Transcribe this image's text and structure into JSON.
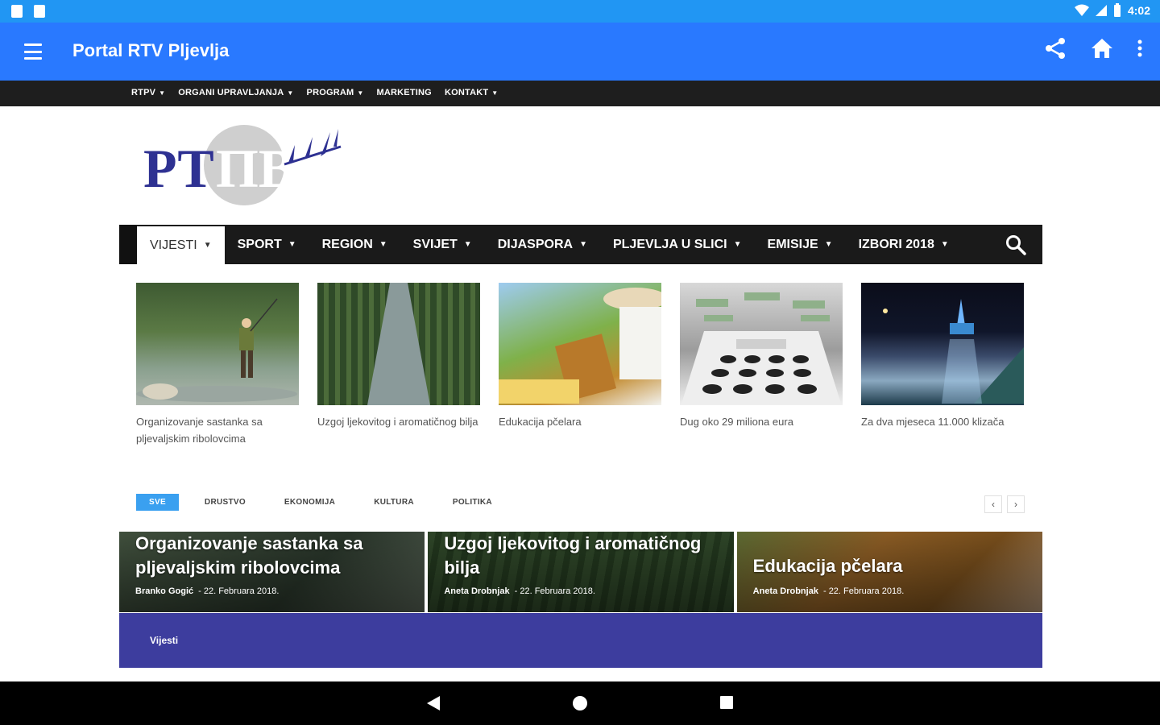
{
  "status_bar": {
    "time": "4:02"
  },
  "app_bar": {
    "title": "Portal RTV Pljevlja"
  },
  "top_nav": {
    "items": [
      {
        "label": "RTPV",
        "caret": true
      },
      {
        "label": "ORGANI UPRAVLJANJA",
        "caret": true
      },
      {
        "label": "PROGRAM",
        "caret": true
      },
      {
        "label": "MARKETING",
        "caret": false
      },
      {
        "label": "KONTAKT",
        "caret": true
      }
    ]
  },
  "logo": {
    "text_left": "РТ",
    "text_circle": "ПВ"
  },
  "main_nav": {
    "items": [
      {
        "label": "VIJESTI",
        "active": true
      },
      {
        "label": "SPORT",
        "active": false
      },
      {
        "label": "REGION",
        "active": false
      },
      {
        "label": "SVIJET",
        "active": false
      },
      {
        "label": "DIJASPORA",
        "active": false
      },
      {
        "label": "PLJEVLJA U SLICI",
        "active": false
      },
      {
        "label": "EMISIJE",
        "active": false
      },
      {
        "label": "IZBORI 2018",
        "active": false
      }
    ]
  },
  "featured": [
    {
      "caption": "Organizovanje sastanka sa pljevaljskim ribolovcima",
      "image": "fisherman"
    },
    {
      "caption": "Uzgoj ljekovitog i aromatičnog bilja",
      "image": "plant-nursery"
    },
    {
      "caption": "Edukacija pčelara",
      "image": "beekeeper"
    },
    {
      "caption": "Dug oko 29 miliona eura",
      "image": "calculator-money"
    },
    {
      "caption": "Za dva mjeseca 11.000 klizača",
      "image": "ice-rink-night"
    }
  ],
  "tabs": [
    "SVE",
    "DRUSTVO",
    "EKONOMIJA",
    "KULTURA",
    "POLITIKA"
  ],
  "big_articles": [
    {
      "title": "Organizovanje sastanka sa pljevaljskim ribolovcima",
      "author": "Branko Gogić",
      "date": "22. Februara 2018."
    },
    {
      "title": "Uzgoj ljekovitog i aromatičnog bilja",
      "author": "Aneta Drobnjak",
      "date": "22. Februara 2018."
    },
    {
      "title": "Edukacija pčelara",
      "author": "Aneta Drobnjak",
      "date": "22. Februara 2018."
    }
  ],
  "section": {
    "label": "Vijesti"
  },
  "colors": {
    "status_bar": "#2196f3",
    "app_bar": "#2979ff",
    "top_nav": "#1e1e1e",
    "main_nav": "#1a1a1a",
    "tab_active": "#3aa0f0",
    "section": "#3d3d9e",
    "logo": "#2e3192"
  }
}
